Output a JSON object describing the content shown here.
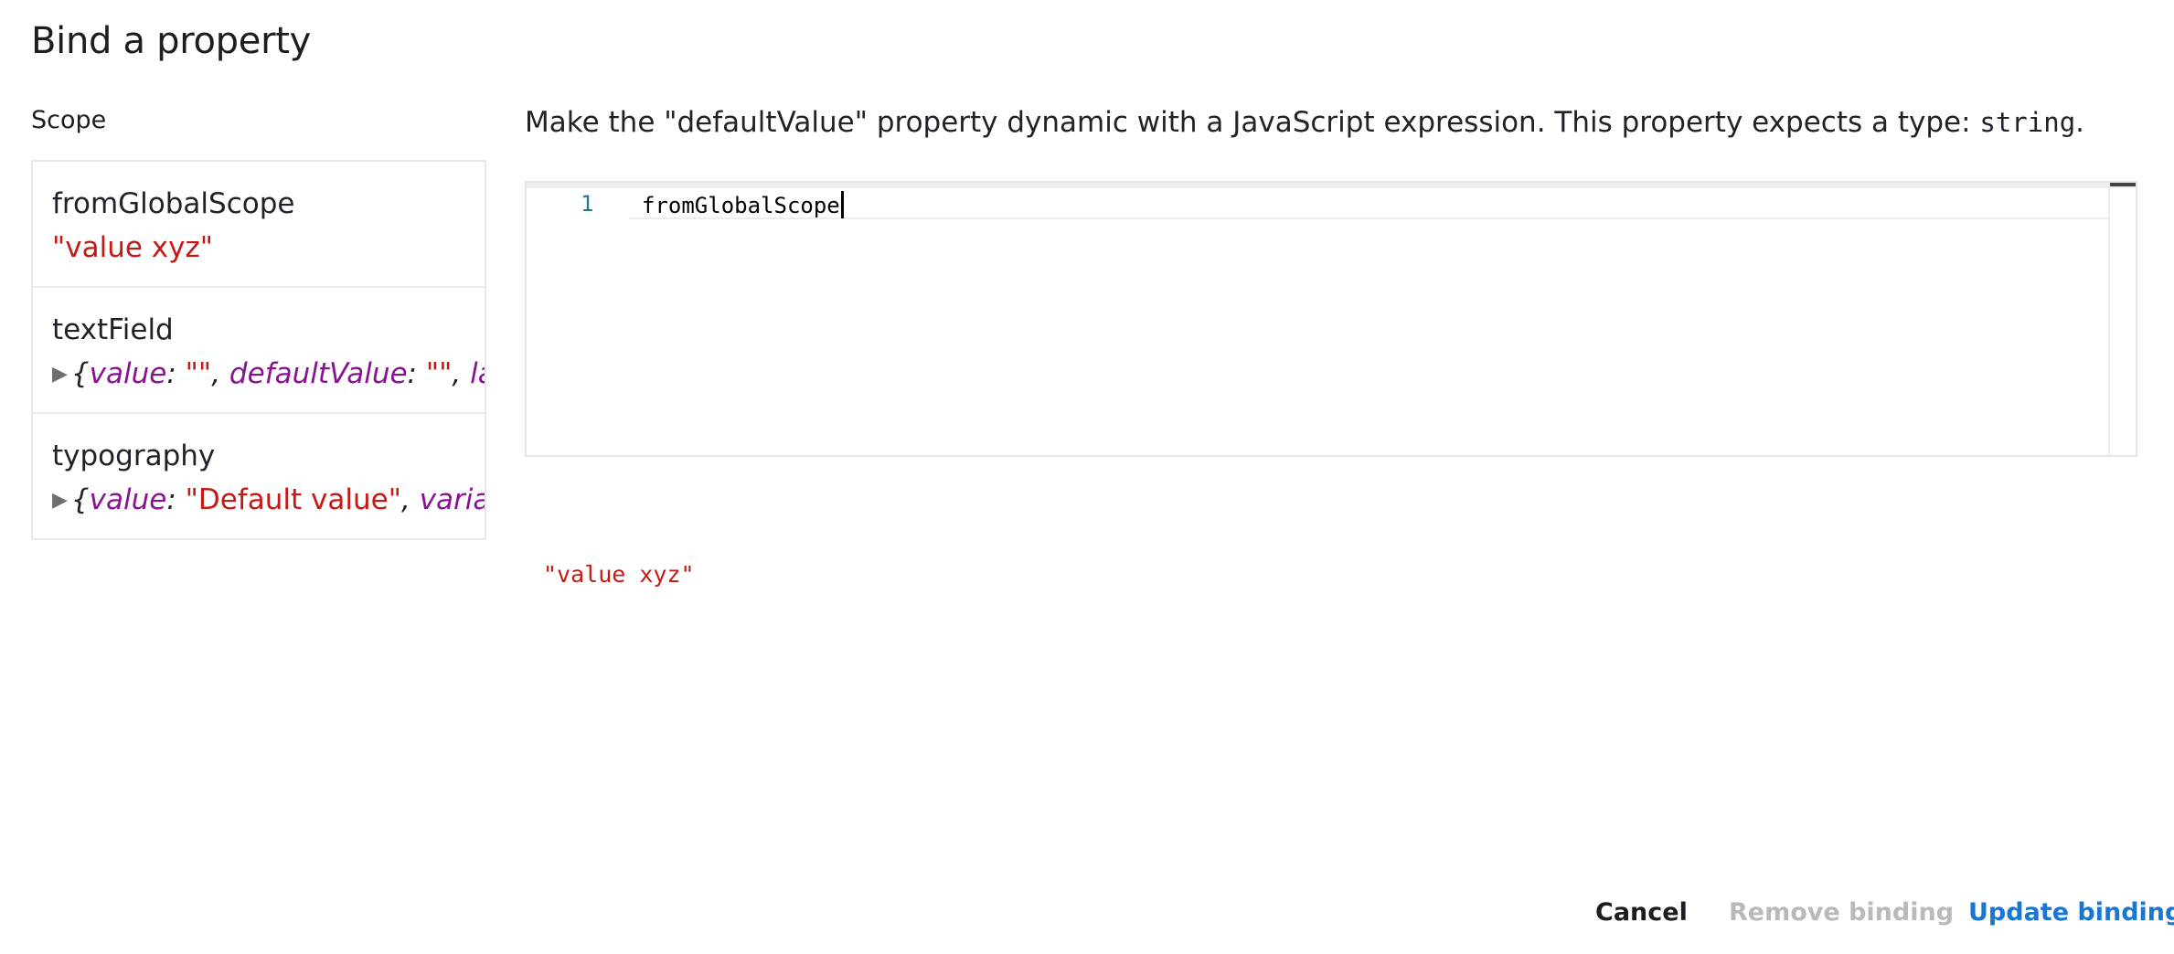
{
  "dialog": {
    "title": "Bind a property"
  },
  "scope": {
    "label": "Scope",
    "items": [
      {
        "name": "fromGlobalScope",
        "value": "\"value xyz\""
      },
      {
        "name": "textField",
        "preview": {
          "k1": "value",
          "v1": "\"\"",
          "k2": "defaultValue",
          "v2": "\"\"",
          "k3": "labe"
        }
      },
      {
        "name": "typography",
        "preview": {
          "k1": "value",
          "v1": "\"Default value\"",
          "k2": "variant"
        }
      }
    ]
  },
  "editor": {
    "description_prefix": "Make the \"defaultValue\" property dynamic with a JavaScript expression. This property expects a type: ",
    "description_type": "string",
    "description_suffix": ".",
    "line_number": "1",
    "code": "fromGlobalScope"
  },
  "result": {
    "value": "\"value xyz\""
  },
  "actions": {
    "cancel": "Cancel",
    "remove": "Remove binding",
    "update": "Update binding"
  },
  "colors": {
    "string": "#c41a16",
    "key": "#881391",
    "accent": "#1976d2",
    "disabled": "#b9b9b9"
  }
}
